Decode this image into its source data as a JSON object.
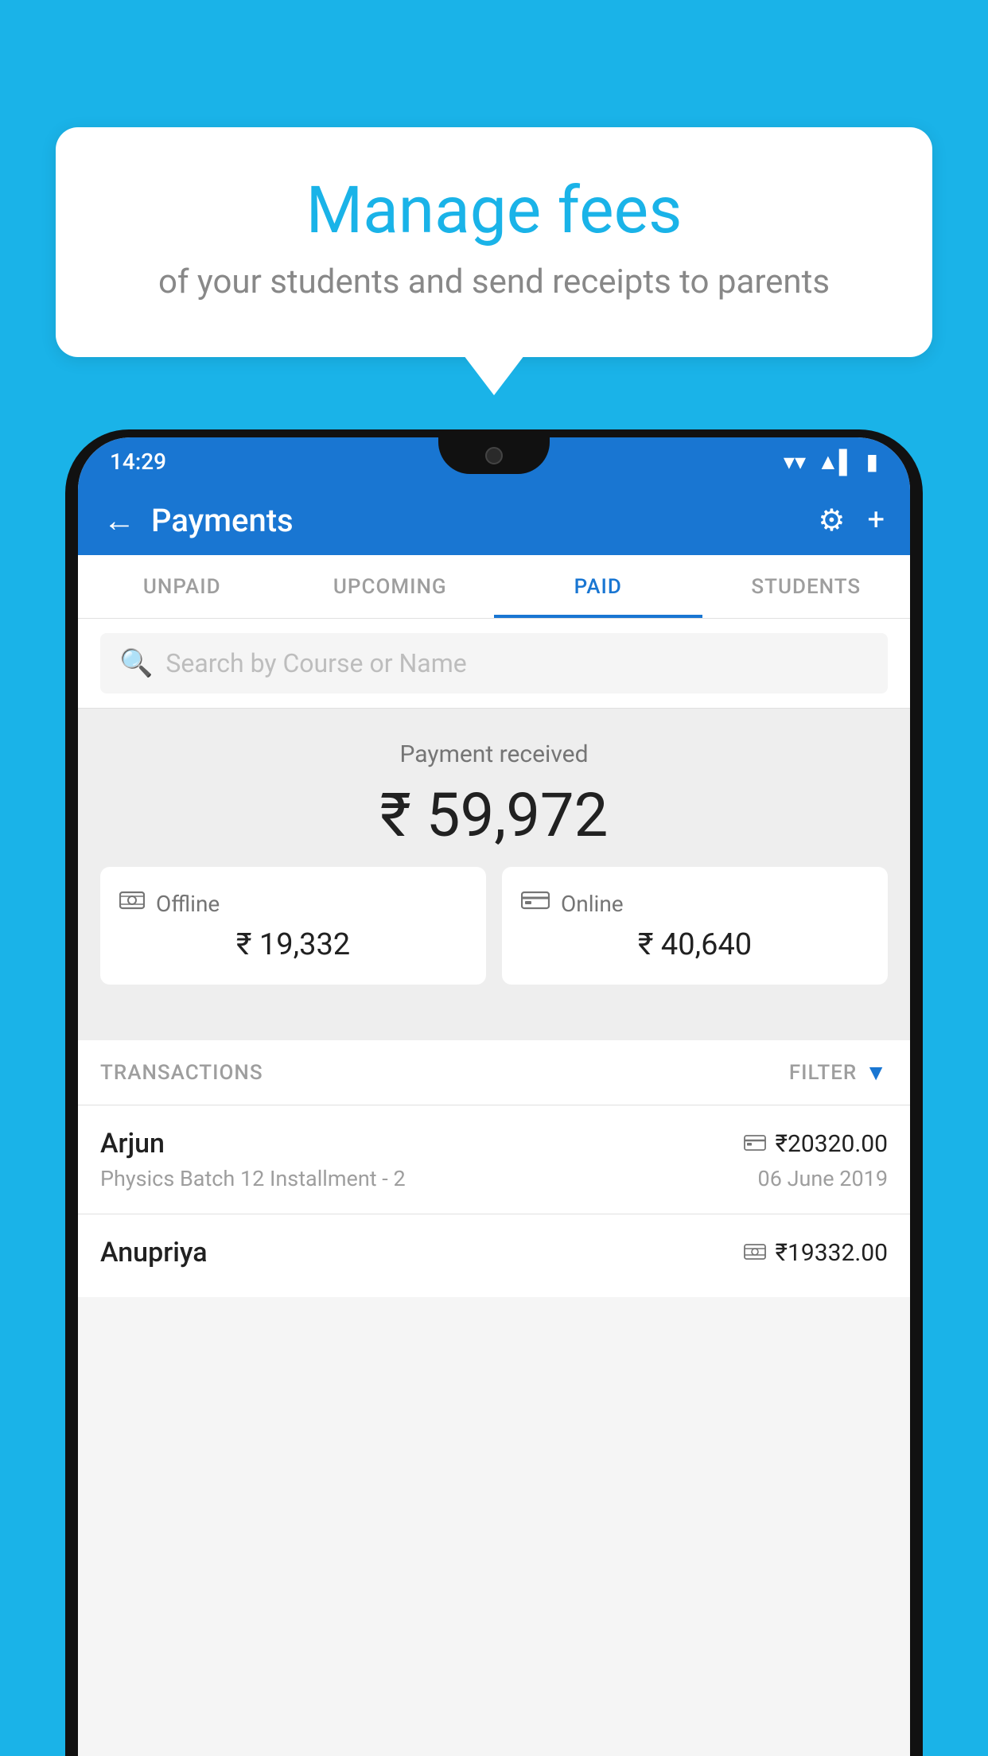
{
  "background_color": "#1ab3e8",
  "bubble": {
    "title": "Manage fees",
    "subtitle": "of your students and send receipts to parents"
  },
  "status_bar": {
    "time": "14:29",
    "wifi": "▲",
    "signal": "▲",
    "battery": "▮"
  },
  "app_bar": {
    "title": "Payments",
    "back_label": "←",
    "settings_label": "⚙",
    "add_label": "+"
  },
  "tabs": [
    {
      "label": "UNPAID",
      "active": false
    },
    {
      "label": "UPCOMING",
      "active": false
    },
    {
      "label": "PAID",
      "active": true
    },
    {
      "label": "STUDENTS",
      "active": false
    }
  ],
  "search": {
    "placeholder": "Search by Course or Name"
  },
  "payment_received": {
    "label": "Payment received",
    "amount": "₹ 59,972"
  },
  "cards": [
    {
      "icon": "💳",
      "label": "Offline",
      "amount": "₹ 19,332"
    },
    {
      "icon": "💳",
      "label": "Online",
      "amount": "₹ 40,640"
    }
  ],
  "transactions_section": {
    "label": "TRANSACTIONS",
    "filter_label": "FILTER"
  },
  "transactions": [
    {
      "name": "Arjun",
      "mode_icon": "💳",
      "amount": "₹20320.00",
      "course": "Physics Batch 12 Installment - 2",
      "date": "06 June 2019"
    },
    {
      "name": "Anupriya",
      "mode_icon": "💵",
      "amount": "₹19332.00",
      "course": "",
      "date": ""
    }
  ]
}
